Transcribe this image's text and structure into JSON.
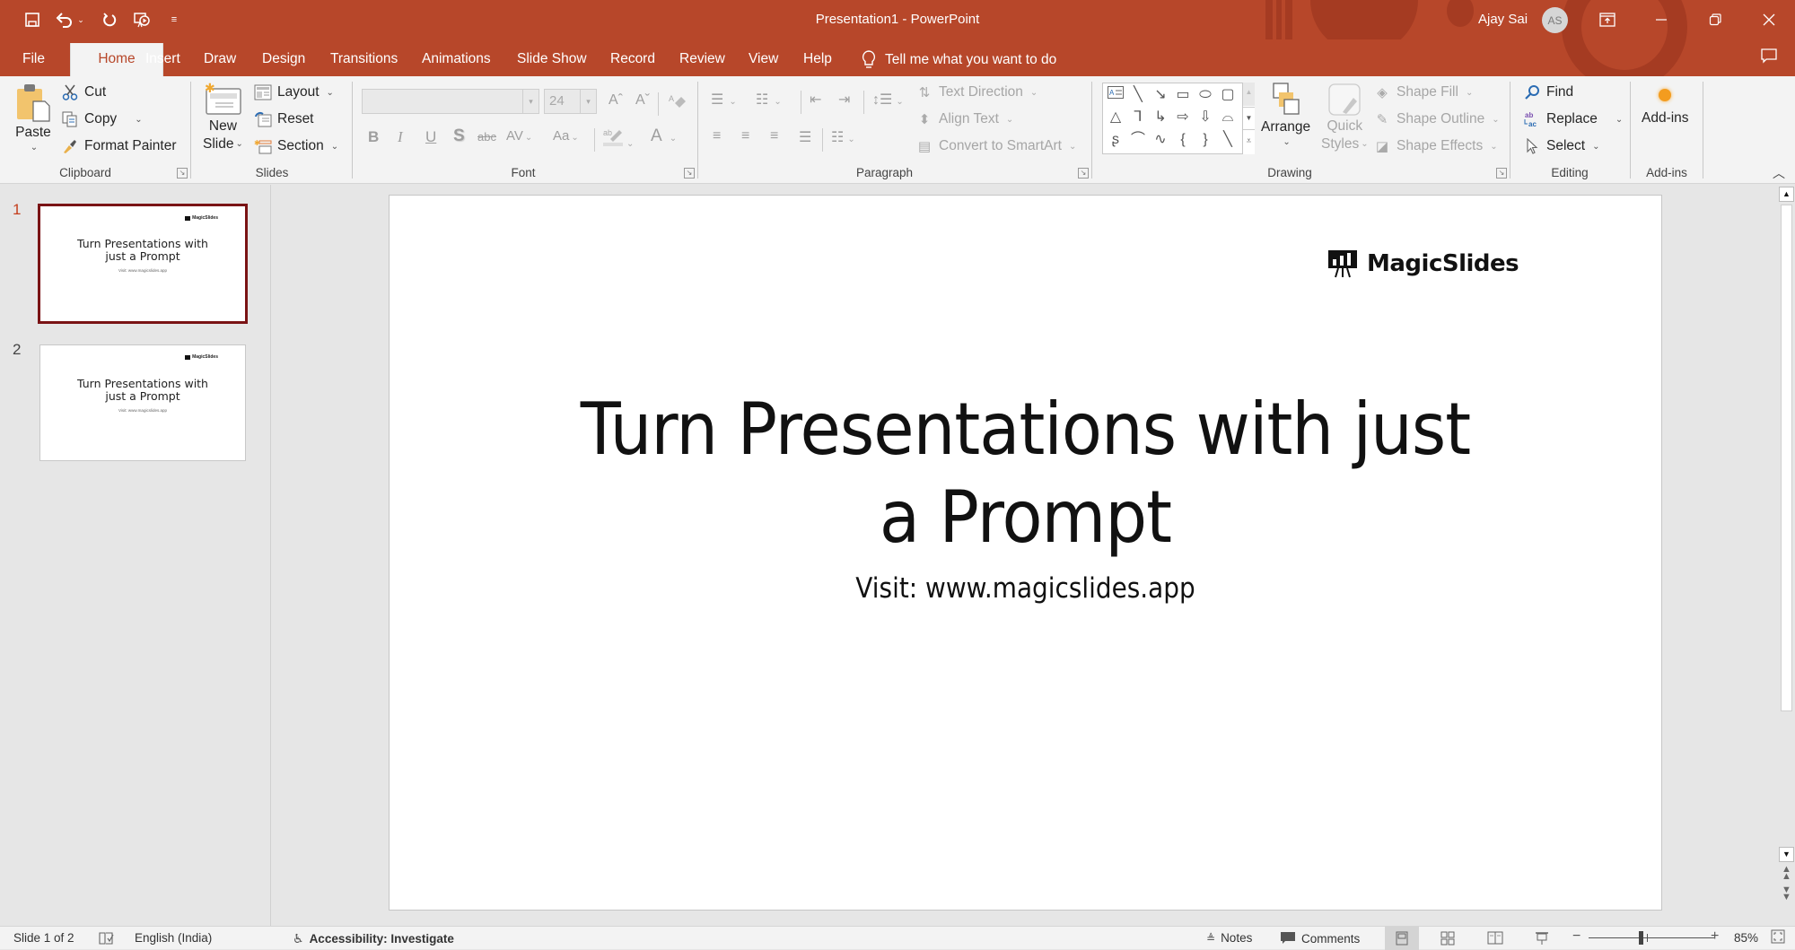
{
  "window": {
    "title": "Presentation1  -  PowerPoint",
    "user_name": "Ajay Sai",
    "user_initials": "AS",
    "accent_color": "#b7472a"
  },
  "qat": {
    "save": "save-icon",
    "undo": "undo-icon",
    "redo": "redo-icon",
    "present": "present-from-beginning-icon",
    "customize": "customize-qat-icon"
  },
  "tabs": [
    {
      "label": "File"
    },
    {
      "label": "Home",
      "active": true
    },
    {
      "label": "Insert"
    },
    {
      "label": "Draw"
    },
    {
      "label": "Design"
    },
    {
      "label": "Transitions"
    },
    {
      "label": "Animations"
    },
    {
      "label": "Slide Show"
    },
    {
      "label": "Record"
    },
    {
      "label": "Review"
    },
    {
      "label": "View"
    },
    {
      "label": "Help"
    }
  ],
  "tell_me": "Tell me what you want to do",
  "ribbon": {
    "clipboard": {
      "label": "Clipboard",
      "paste": "Paste",
      "cut": "Cut",
      "copy": "Copy",
      "format_painter": "Format Painter"
    },
    "slides": {
      "label": "Slides",
      "new_slide_line1": "New",
      "new_slide_line2": "Slide",
      "layout": "Layout",
      "reset": "Reset",
      "section": "Section"
    },
    "font": {
      "label": "Font",
      "font_name": "",
      "font_size": "24",
      "bold": "B",
      "italic": "I",
      "underline": "U",
      "shadow": "S",
      "strikethrough": "abc",
      "spacing": "AV",
      "change_case": "Aa",
      "font_color": "A"
    },
    "paragraph": {
      "label": "Paragraph",
      "text_direction": "Text Direction",
      "align_text": "Align Text",
      "convert_smartart": "Convert to SmartArt"
    },
    "drawing": {
      "label": "Drawing",
      "arrange": "Arrange",
      "quick_styles_line1": "Quick",
      "quick_styles_line2": "Styles",
      "shape_fill": "Shape Fill",
      "shape_outline": "Shape Outline",
      "shape_effects": "Shape Effects"
    },
    "editing": {
      "label": "Editing",
      "find": "Find",
      "replace": "Replace",
      "select": "Select"
    },
    "addins": {
      "label": "Add-ins",
      "button": "Add-ins"
    }
  },
  "thumbnails": [
    {
      "number": "1",
      "title": "Turn Presentations with just a Prompt",
      "subtitle": "Visit: www.magicslides.app",
      "logo": "MagicSlides",
      "selected": true
    },
    {
      "number": "2",
      "title": "Turn Presentations with just a Prompt",
      "subtitle": "Visit: www.magicslides.app",
      "logo": "MagicSlides",
      "selected": false
    }
  ],
  "slide": {
    "logo_text": "MagicSlides",
    "title_line1": "Turn Presentations with just",
    "title_line2": "a Prompt",
    "subtitle": "Visit: www.magicslides.app"
  },
  "status": {
    "slide_info": "Slide 1 of 2",
    "language": "English (India)",
    "accessibility": "Accessibility: Investigate",
    "notes": "Notes",
    "comments": "Comments",
    "zoom_percent": "85%",
    "zoom_value": 85
  }
}
